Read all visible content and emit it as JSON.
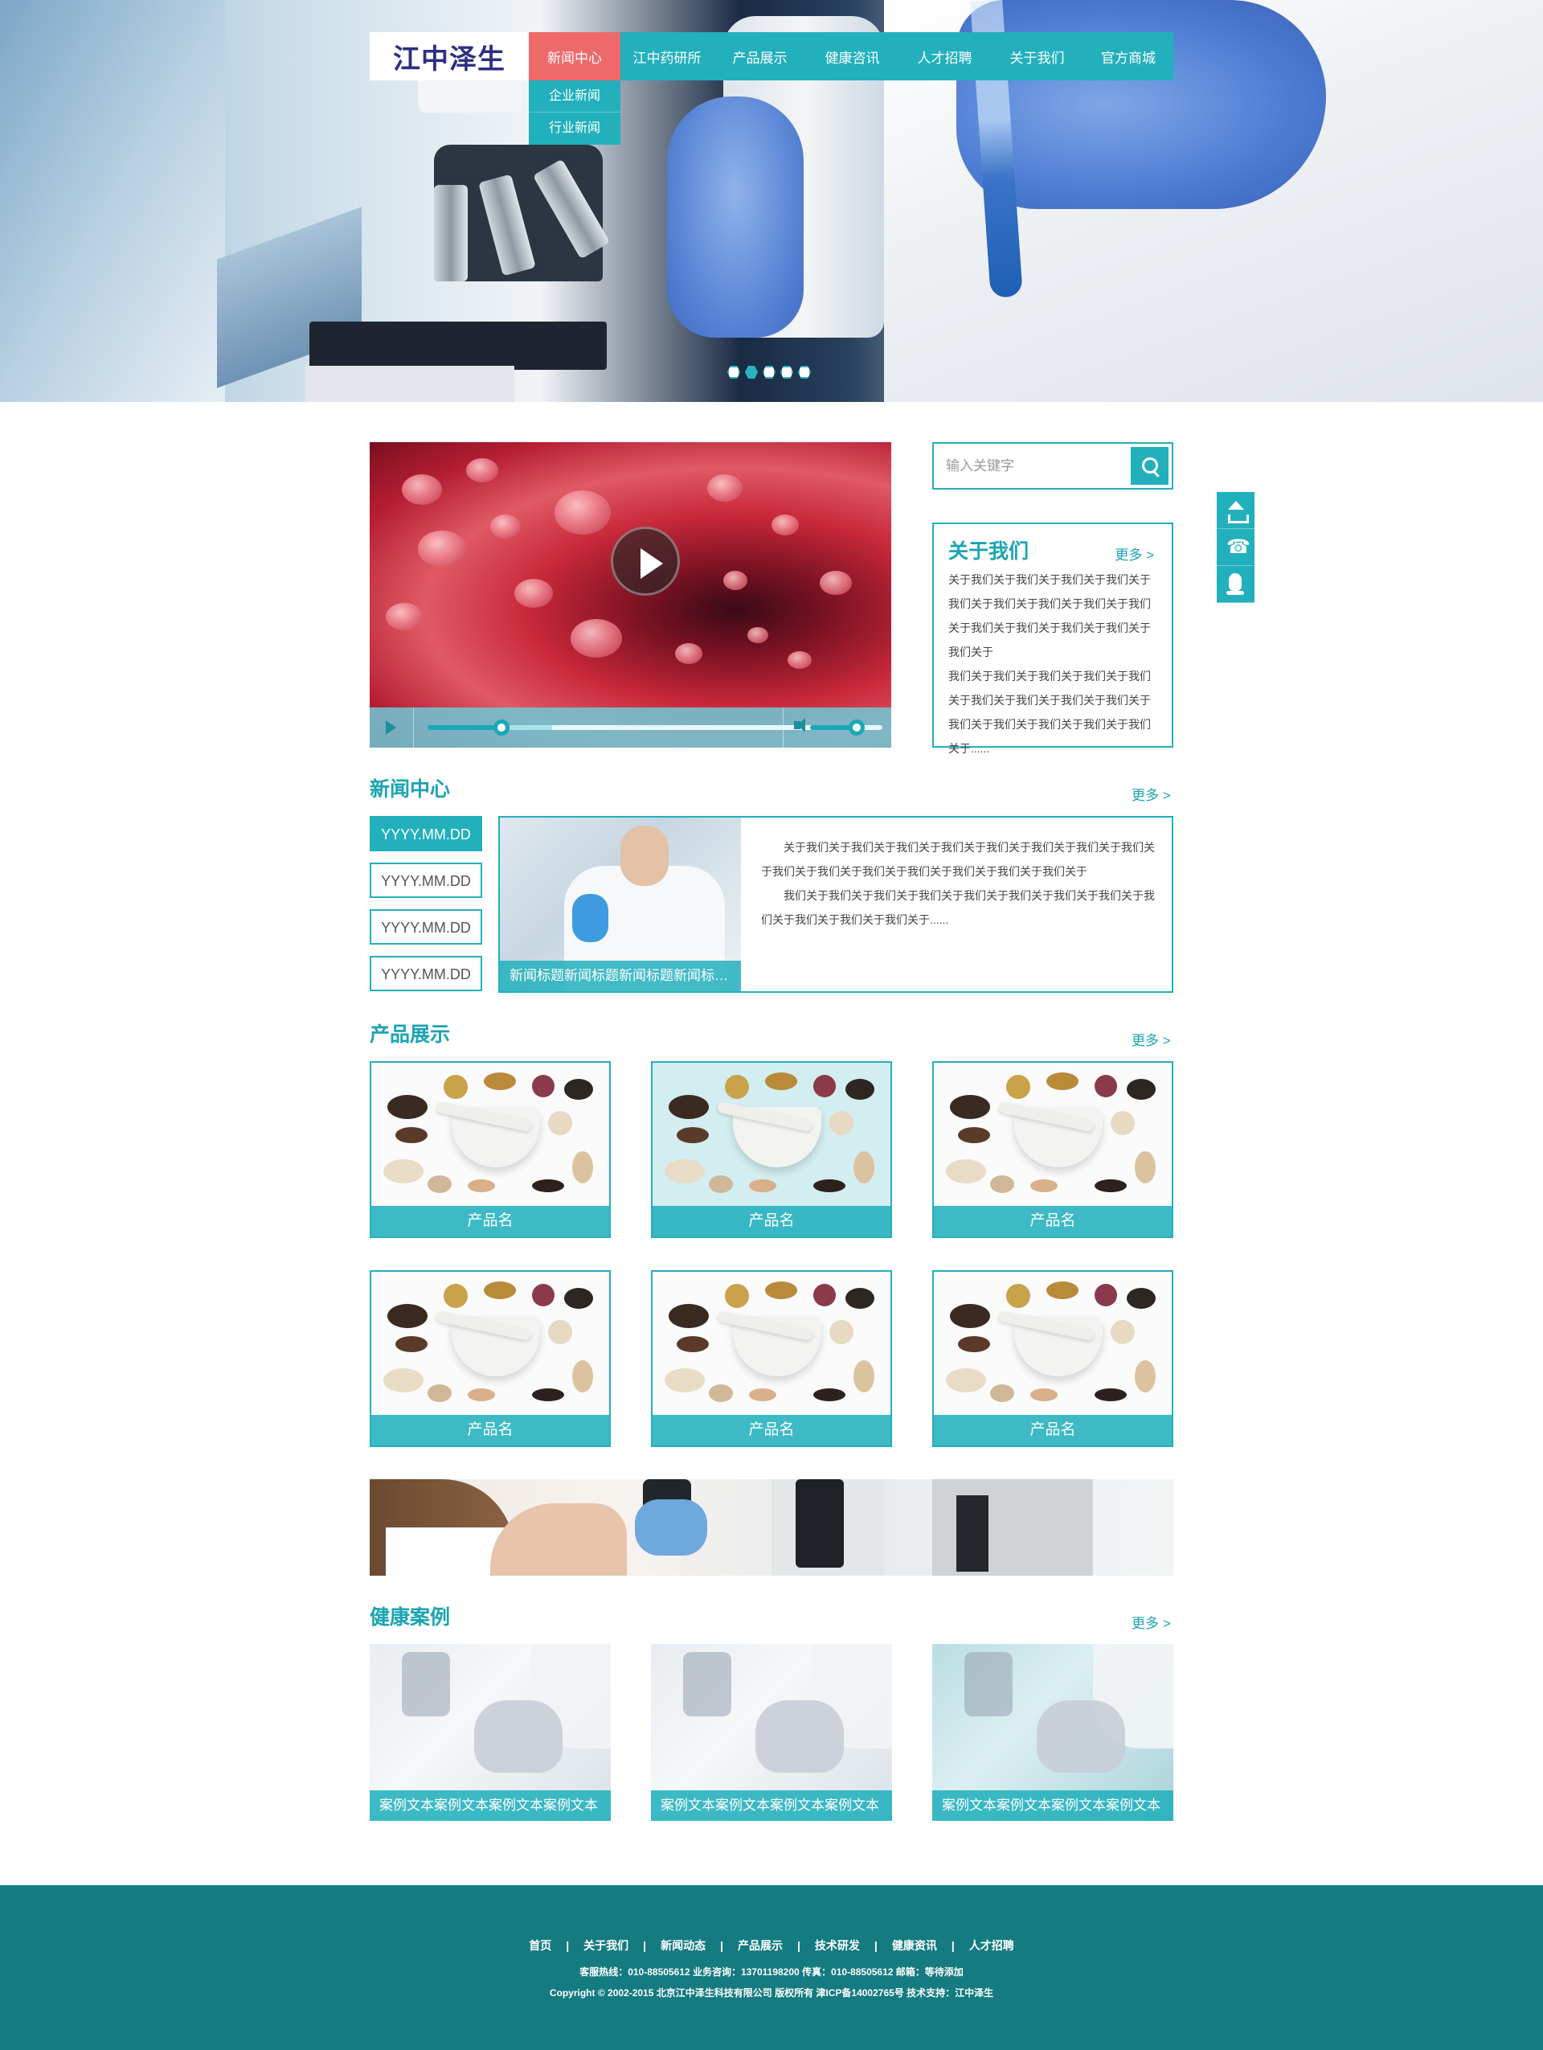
{
  "header": {
    "logo_text": "江中泽生",
    "nav": [
      {
        "label": "新闻中心",
        "active": true
      },
      {
        "label": "江中药研所"
      },
      {
        "label": "产品展示"
      },
      {
        "label": "健康咨讯"
      },
      {
        "label": "人才招聘"
      },
      {
        "label": "关于我们"
      },
      {
        "label": "官方商城"
      }
    ],
    "submenu": [
      "企业新闻",
      "行业新闻"
    ]
  },
  "slider": {
    "count": 5,
    "active_index": 1
  },
  "video": {
    "progress_fraction": 0.19,
    "buffered_fraction": 0.32,
    "volume_fraction": 0.64
  },
  "search": {
    "placeholder": "输入关键字"
  },
  "about": {
    "title": "关于我们",
    "more": "更多 >",
    "paragraph1": "关于我们关于我们关于我们关于我们关于我们关于我们关于我们关于我们关于我们关于我们关于我们关于我们关于我们关于我们关于",
    "paragraph2": "我们关于我们关于我们关于我们关于我们关于我们关于我们关于我们关于我们关于我们关于我们关于我们关于我们关于我们关于......"
  },
  "news": {
    "title": "新闻中心",
    "more": "更多 >",
    "dates": [
      "YYYY.MM.DD",
      "YYYY.MM.DD",
      "YYYY.MM.DD",
      "YYYY.MM.DD"
    ],
    "image_caption": "新闻标题新闻标题新闻标题新闻标题新闻标题",
    "paragraph1": "关于我们关于我们关于我们关于我们关于我们关于我们关于我们关于我们关于我们关于我们关于我们关于我们关于我们关于我们关于我们关于",
    "paragraph2": "我们关于我们关于我们关于我们关于我们关于我们关于我们关于我们关于我们关于我们关于我们关于我们关于......"
  },
  "products": {
    "title": "产品展示",
    "more": "更多 >",
    "items": [
      "产品名",
      "产品名",
      "产品名",
      "产品名",
      "产品名",
      "产品名"
    ]
  },
  "cases": {
    "title": "健康案例",
    "more": "更多 >",
    "items": [
      "案例文本案例文本案例文本案例文本",
      "案例文本案例文本案例文本案例文本",
      "案例文本案例文本案例文本案例文本"
    ]
  },
  "footer": {
    "links": [
      "首页",
      "关于我们",
      "新闻动态",
      "产品展示",
      "技术研发",
      "健康资讯",
      "人才招聘"
    ],
    "separator": "|",
    "info": "客服热线：010-88505612  业务咨询：13701198200  传真：010-88505612  邮箱：等待添加",
    "copyright": "Copyright © 2002-2015 北京江中泽生科技有限公司 版权所有 津ICP备14002765号 技术支持：江中泽生"
  },
  "colors": {
    "accent": "#22b0bd",
    "accent_dark": "#1ba4b2",
    "nav_active": "#ee6a6a",
    "footer_bg": "#147b80",
    "logo": "#2c2f83"
  }
}
